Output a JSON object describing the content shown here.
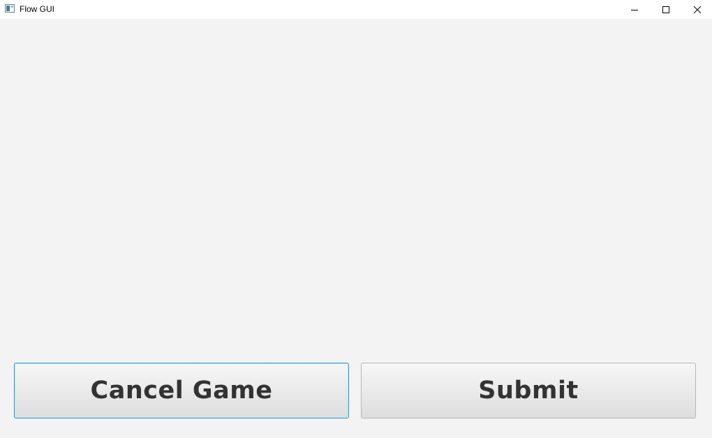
{
  "window": {
    "title": "Flow GUI",
    "controls": {
      "minimize_icon": "minimize-icon",
      "maximize_icon": "maximize-icon",
      "close_icon": "close-icon"
    }
  },
  "actions": {
    "cancel_label": "Cancel Game",
    "submit_label": "Submit"
  },
  "colors": {
    "background": "#f3f3f3",
    "focus_border": "#1b9fd8",
    "button_text": "#333333"
  }
}
